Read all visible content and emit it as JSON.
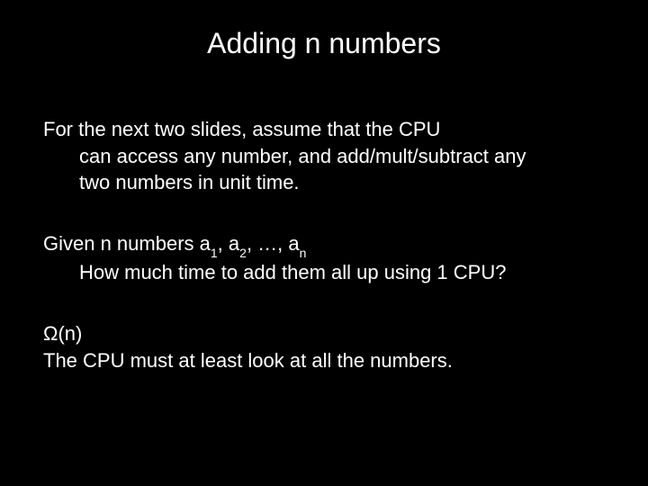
{
  "title": "Adding n numbers",
  "p1_line1": "For the next two slides, assume that the CPU",
  "p1_line2": "can access any number, and add/mult/subtract any",
  "p1_line3": "two numbers in unit time.",
  "p2_prefix": "Given n numbers a",
  "p2_sub1": "1",
  "p2_mid1": ", a",
  "p2_sub2": "2",
  "p2_mid2": ", …, a",
  "p2_sub3": "n",
  "p2_line2": "How much time to add them all up using 1 CPU?",
  "p3_line1": "Ω(n)",
  "p3_line2": "The CPU must at least look at all the numbers."
}
